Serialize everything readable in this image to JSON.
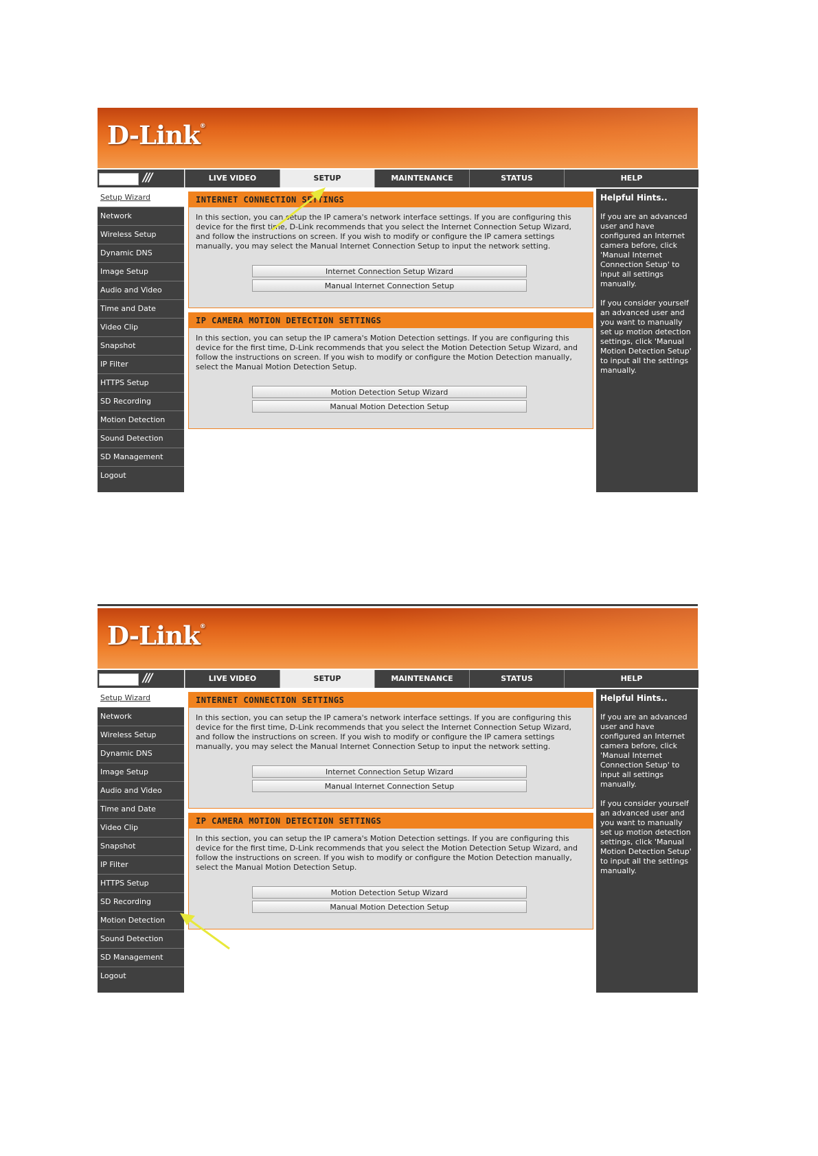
{
  "logo": {
    "text": "D-Link",
    "mark": "®"
  },
  "tabs": [
    "LIVE VIDEO",
    "SETUP",
    "MAINTENANCE",
    "STATUS",
    "HELP"
  ],
  "sidebar": {
    "items": [
      "Setup Wizard",
      "Network",
      "Wireless Setup",
      "Dynamic DNS",
      "Image Setup",
      "Audio and Video",
      "Time and Date",
      "Video Clip",
      "Snapshot",
      "IP Filter",
      "HTTPS Setup",
      "SD Recording",
      "Motion Detection",
      "Sound Detection",
      "SD Management",
      "Logout"
    ]
  },
  "internet": {
    "title": "INTERNET CONNECTION SETTINGS",
    "text": "In this section, you can setup the IP camera's network interface settings. If you are configuring this device for the first time, D-Link recommends that you select the Internet Connection Setup Wizard, and follow the instructions on screen. If you wish to modify or configure the IP camera settings manually, you may select the Manual Internet Connection Setup to input the network setting.",
    "wizard_button": "Internet Connection Setup Wizard",
    "manual_button": "Manual Internet Connection Setup"
  },
  "motion": {
    "title": "IP CAMERA MOTION DETECTION SETTINGS",
    "text": "In this section, you can setup the IP camera's Motion Detection settings. If you are configuring this device for the first time, D-Link recommends that you select the Motion Detection Setup Wizard, and follow the instructions on screen. If you wish to modify or configure the Motion Detection manually, select the Manual Motion Detection Setup.",
    "wizard_button": "Motion Detection Setup Wizard",
    "manual_button": "Manual Motion Detection Setup"
  },
  "hints": {
    "title": "Helpful Hints..",
    "p1": "If you are an advanced user and have configured an Internet camera before, click 'Manual Internet Connection Setup' to input all settings manually.",
    "p2": "If you consider yourself an advanced user and you want to manually set up motion detection settings, click 'Manual Motion Detection Setup' to input all the settings manually."
  },
  "colors": {
    "accent": "#f0821e",
    "dark": "#404040",
    "arrow": "#e8e83a"
  }
}
